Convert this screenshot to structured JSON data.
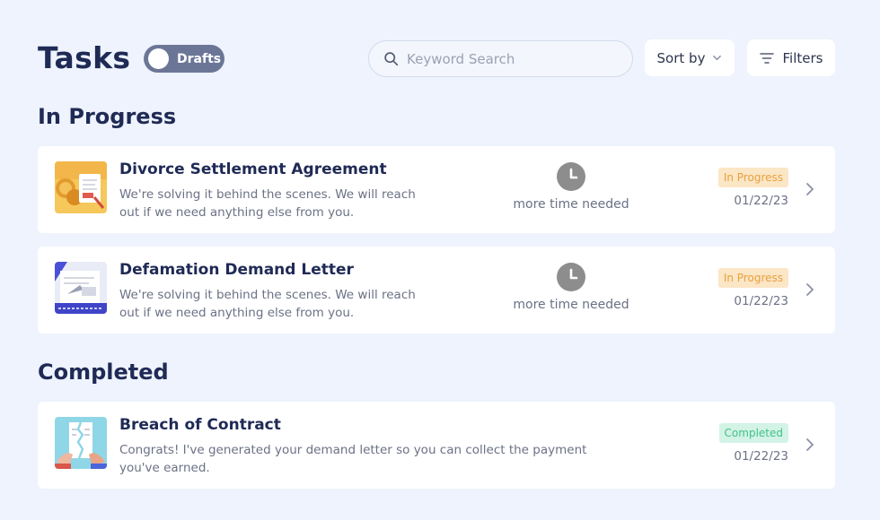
{
  "header": {
    "title": "Tasks",
    "drafts_toggle_label": "Drafts",
    "search_placeholder": "Keyword Search",
    "sort_label": "Sort by",
    "filters_label": "Filters"
  },
  "sections": {
    "in_progress": {
      "heading": "In Progress",
      "tasks": [
        {
          "title": "Divorce Settlement Agreement",
          "description": "We're solving it behind the scenes. We will reach out if we need anything else from you.",
          "eta": "more time needed",
          "status": "In Progress",
          "date": "01/22/23",
          "thumbnail_icon": "document-coins-thumbnail"
        },
        {
          "title": "Defamation Demand Letter",
          "description": "We're solving it behind the scenes. We will reach out if we need anything else from you.",
          "eta": "more time needed",
          "status": "In Progress",
          "date": "01/22/23",
          "thumbnail_icon": "letter-thumbnail"
        }
      ]
    },
    "completed": {
      "heading": "Completed",
      "tasks": [
        {
          "title": "Breach of Contract",
          "description": "Congrats! I've generated your demand letter so you can collect the payment you've earned.",
          "status": "Completed",
          "date": "01/22/23",
          "thumbnail_icon": "torn-contract-thumbnail"
        }
      ]
    }
  },
  "colors": {
    "background": "#eef3fd",
    "heading": "#1f2a55",
    "in_progress_badge_bg": "#fbe6c6",
    "in_progress_badge_text": "#e8a13e",
    "completed_badge_bg": "#d3f3e6",
    "completed_badge_text": "#44c08c",
    "toggle": "#6b7697"
  }
}
